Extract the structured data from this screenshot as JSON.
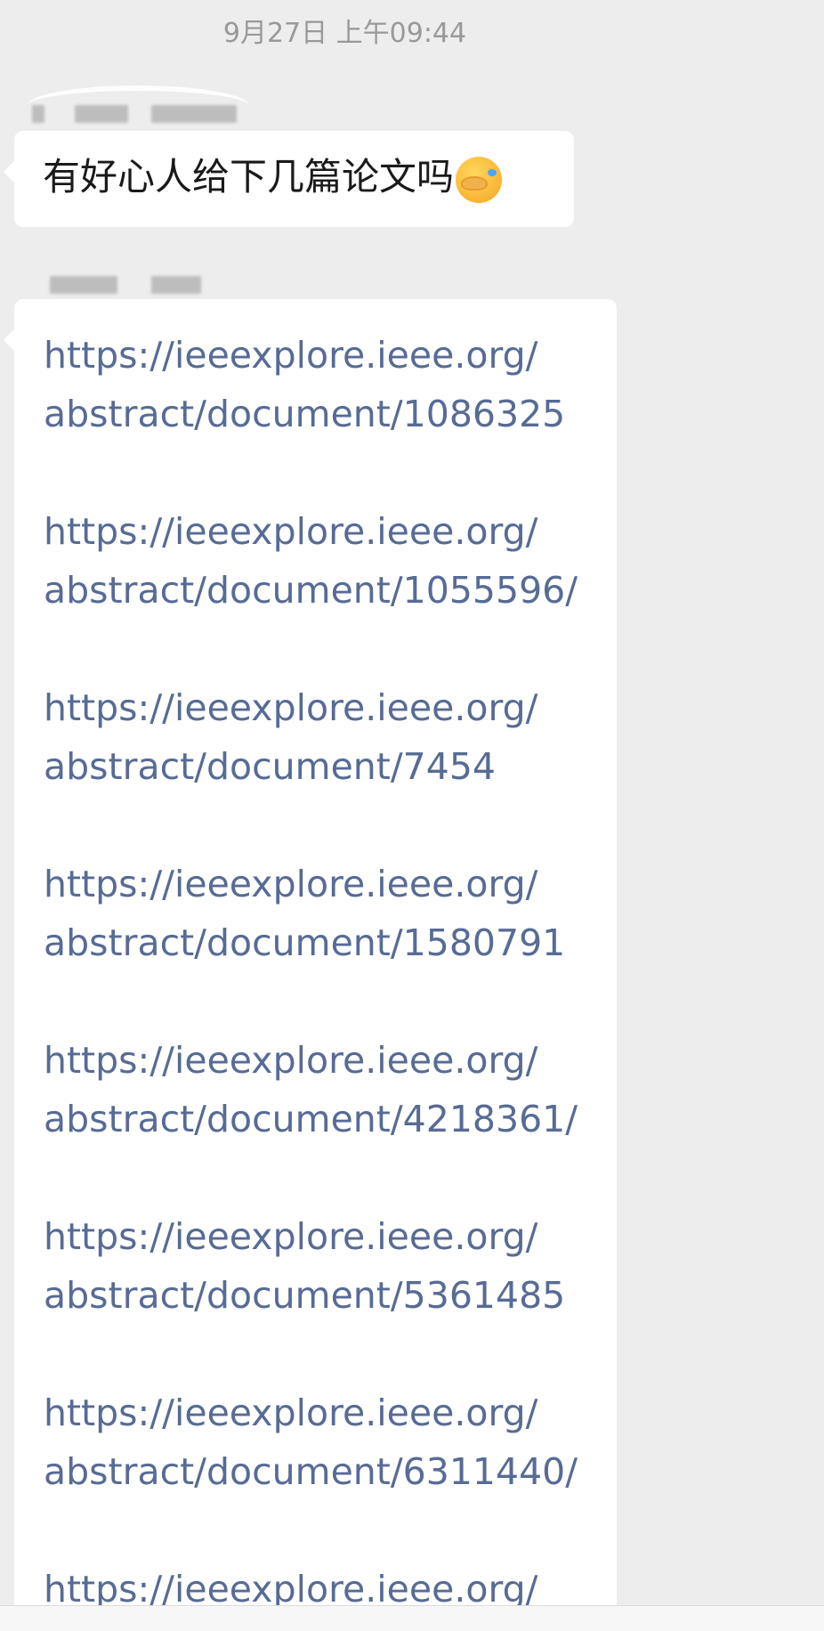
{
  "chat": {
    "timestamp": "9月27日 上午09:44",
    "messages": [
      {
        "type": "text",
        "text": "有好心人给下几篇论文吗",
        "emoji": "facepalm-emoji"
      },
      {
        "type": "links",
        "items": [
          {
            "line1": "https://ieeexplore.ieee.org/",
            "line2": "abstract/document/1086325"
          },
          {
            "line1": "https://ieeexplore.ieee.org/",
            "line2": "abstract/document/1055596/"
          },
          {
            "line1": "https://ieeexplore.ieee.org/",
            "line2": "abstract/document/7454"
          },
          {
            "line1": "https://ieeexplore.ieee.org/",
            "line2": "abstract/document/1580791"
          },
          {
            "line1": "https://ieeexplore.ieee.org/",
            "line2": "abstract/document/4218361/"
          },
          {
            "line1": "https://ieeexplore.ieee.org/",
            "line2": "abstract/document/5361485"
          },
          {
            "line1": "https://ieeexplore.ieee.org/",
            "line2": "abstract/document/6311440/"
          },
          {
            "line1": "https://ieeexplore.ieee.org/",
            "line2": ""
          }
        ]
      }
    ]
  },
  "colors": {
    "background": "#ededed",
    "bubble": "#ffffff",
    "link": "#576b95",
    "timestamp": "#999999"
  }
}
